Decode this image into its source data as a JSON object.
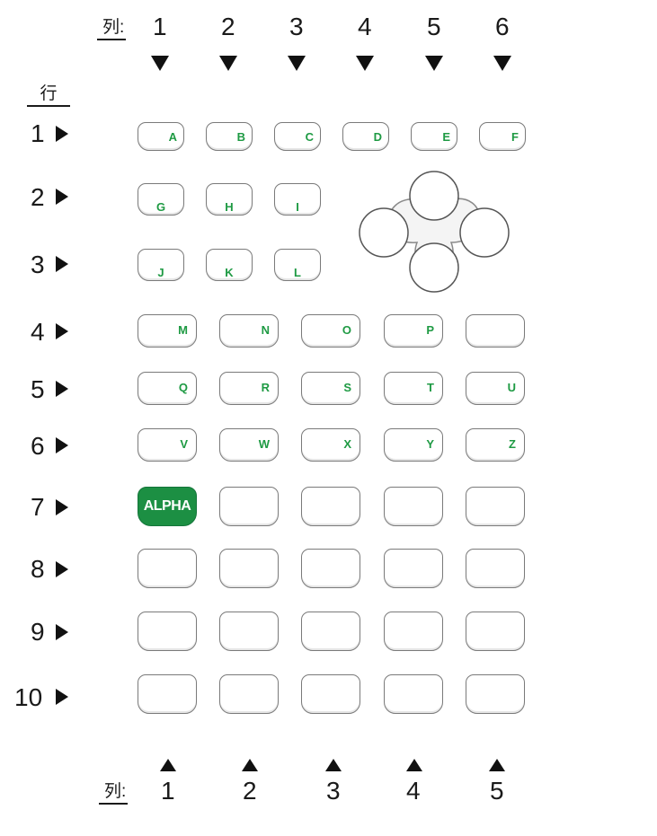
{
  "column_heading": "列:",
  "row_heading": "行",
  "top_columns": [
    "1",
    "2",
    "3",
    "4",
    "5",
    "6"
  ],
  "bottom_columns": [
    "1",
    "2",
    "3",
    "4",
    "5"
  ],
  "rows": [
    "1",
    "2",
    "3",
    "4",
    "5",
    "6",
    "7",
    "8",
    "9",
    "10"
  ],
  "keys": {
    "row1": [
      "A",
      "B",
      "C",
      "D",
      "E",
      "F"
    ],
    "row2": [
      "G",
      "H",
      "I"
    ],
    "row3": [
      "J",
      "K",
      "L"
    ],
    "row4": [
      "M",
      "N",
      "O",
      "P",
      ""
    ],
    "row5": [
      "Q",
      "R",
      "S",
      "T",
      "U"
    ],
    "row6": [
      "V",
      "W",
      "X",
      "Y",
      "Z"
    ],
    "alpha": "ALPHA"
  },
  "colors": {
    "letter_green": "#1e9a43",
    "alpha_green": "#1c8f43",
    "outline": "#7a7a7a"
  },
  "icons": {
    "dpad": "directional-pad-icon",
    "column_marker": "triangle-down-icon",
    "row_marker": "triangle-right-icon",
    "bottom_marker": "triangle-up-icon"
  }
}
